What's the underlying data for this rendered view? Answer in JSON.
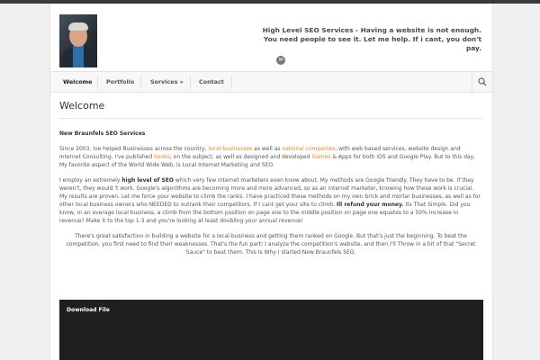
{
  "header": {
    "tagline": "High Level SEO Services - Having a website is not enough. You need people to see it. Let me help. If i cant, you don't pay.",
    "social_icon": "email-icon"
  },
  "nav": {
    "items": [
      "Welcome",
      "Portfolio",
      "Services »",
      "Contact"
    ],
    "active": "Welcome",
    "search_icon": "search-icon"
  },
  "main": {
    "title": "Welcome",
    "subheading": "New Braunfels SEO Services",
    "p1": {
      "t1": "Since 2003, Ive helped Businesses across the country, ",
      "l1": "local businesses",
      "t2": " as well as ",
      "l2": "national companies",
      "t3": ", with web based services, website design and Internet Consulting. I've published ",
      "l3": "books",
      "t4": ", on the subject, as well as designed and developed ",
      "l4": "Games",
      "t5": " & Apps for both iOS and Google Play. But to this day, My favorite aspect of the World Wide Web, is Local Internet Marketing and SEO."
    },
    "p2": {
      "t1": "I employ an extremely ",
      "b1": "high level of SEO",
      "t2": " which very few internet marketers even know about. My methods are Google friendly. They have to be. If they weren't, they would 't work. Google's algorithms are becoming more and more advanced, so as an internet marketer, knowing how these work is crucial. My results are proven. Let me force your website to climb the ranks. I have practiced these methods on my own brick and mortar businesses, as well as for other local business owners who NEEDED to outrank their competitors. If I cant get your site to climb, ",
      "b2": "Ill refund your money.",
      "t3": " Its That Simple. Did you know, in an average local business, a climb from the bottom position on page one to the middle position on page one equates to a 50% increase in revenue? Make it to the top 1-3 and you're looking at least doubling your annual revenue!"
    },
    "p3": "There's great satisfaction in building a website for a local business and getting them ranked on Google. But that's just the beginning. To beat the competition, you first need to find their weaknesses. That's the fun part! I analyze the competition's website, and then I'll Throw in a bit of that \"Secret Sauce\" to beat them. This Is Why I started New Braunfels SEO.",
    "download_label": "Download File"
  },
  "colors": {
    "accent_link": "#e8862a",
    "download_bg": "#1f1f1f",
    "top_bar": "#3a3a3a"
  }
}
